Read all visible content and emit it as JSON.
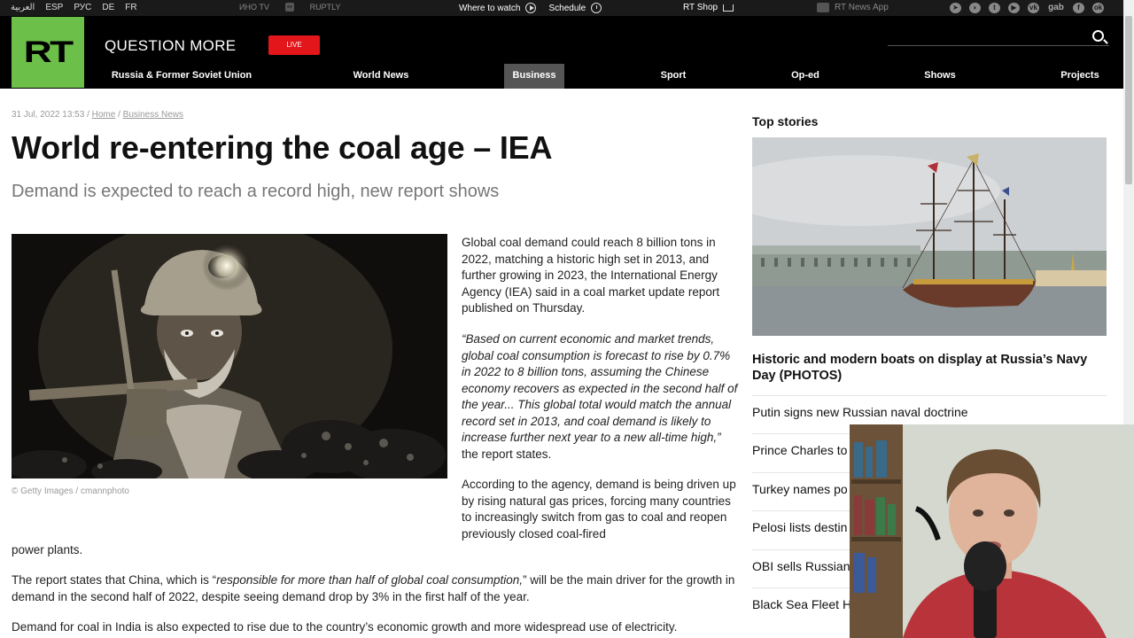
{
  "topbar": {
    "languages": [
      "العربية",
      "ESP",
      "РУС",
      "DE",
      "FR"
    ],
    "brands": [
      "ИНО TV",
      "RUPTLY"
    ],
    "where_to_watch": "Where to watch",
    "schedule": "Schedule",
    "rt_shop": "RT Shop",
    "rt_news_app": "RT News App",
    "social": [
      "telegram-icon",
      "rss-icon",
      "twitter-icon",
      "youtube-icon",
      "vk-icon",
      "gab",
      "facebook-icon",
      "odnoklassniki-icon"
    ],
    "gab": "gab"
  },
  "header": {
    "logo": "RT",
    "tagline": "QUESTION MORE",
    "live": "LIVE",
    "accent": "#6cc04a",
    "live_color": "#e2161b"
  },
  "nav": {
    "items": [
      "Russia & Former Soviet Union",
      "World News",
      "Business",
      "Sport",
      "Op-ed",
      "Shows",
      "Projects"
    ],
    "active": "Business"
  },
  "article": {
    "date": "31 Jul, 2022 13:53",
    "sep": "/",
    "crumb_home": "Home",
    "crumb_section": "Business News",
    "title": "World re-entering the coal age – IEA",
    "subtitle": "Demand is expected to reach a record high, new report shows",
    "image_caption": "© Getty Images / cmannphoto",
    "p1": "Global coal demand could reach 8 billion tons in 2022, matching a historic high set in 2013, and further growing in 2023, the International Energy Agency (IEA) said in a coal market update report published on Thursday.",
    "p2_quote": "“Based on current economic and market trends, global coal consumption is forecast to rise by 0.7% in 2022 to 8 billion tons, assuming the Chinese economy recovers as expected in the second half of the year... This global total would match the annual record set in 2013, and coal demand is likely to increase further next year to a new all-time high,”",
    "p2_tail": " the report states.",
    "p3a": "According to the agency, demand is being driven up by rising natural gas prices, forcing many countries to increasingly switch from gas to coal and reopen previously closed coal-fired",
    "p3b": "power plants.",
    "p4_pre": "The report states that China, which is “",
    "p4_quote": "responsible for more than half of global coal consumption,",
    "p4_post": "” will be the main driver for the growth in demand in the second half of 2022, despite seeing demand drop by 3% in the first half of the year.",
    "p5": "Demand for coal in India is also expected to rise due to the country’s economic growth and more widespread use of electricity."
  },
  "sidebar": {
    "title": "Top stories",
    "headline": "Historic and modern boats on display at Russia’s Navy Day (PHOTOS)",
    "items": [
      "Putin signs new Russian naval doctrine",
      "Prince Charles to",
      "Turkey names po",
      "Pelosi lists destin",
      "OBI sells Russian",
      "Black Sea Fleet H"
    ]
  }
}
